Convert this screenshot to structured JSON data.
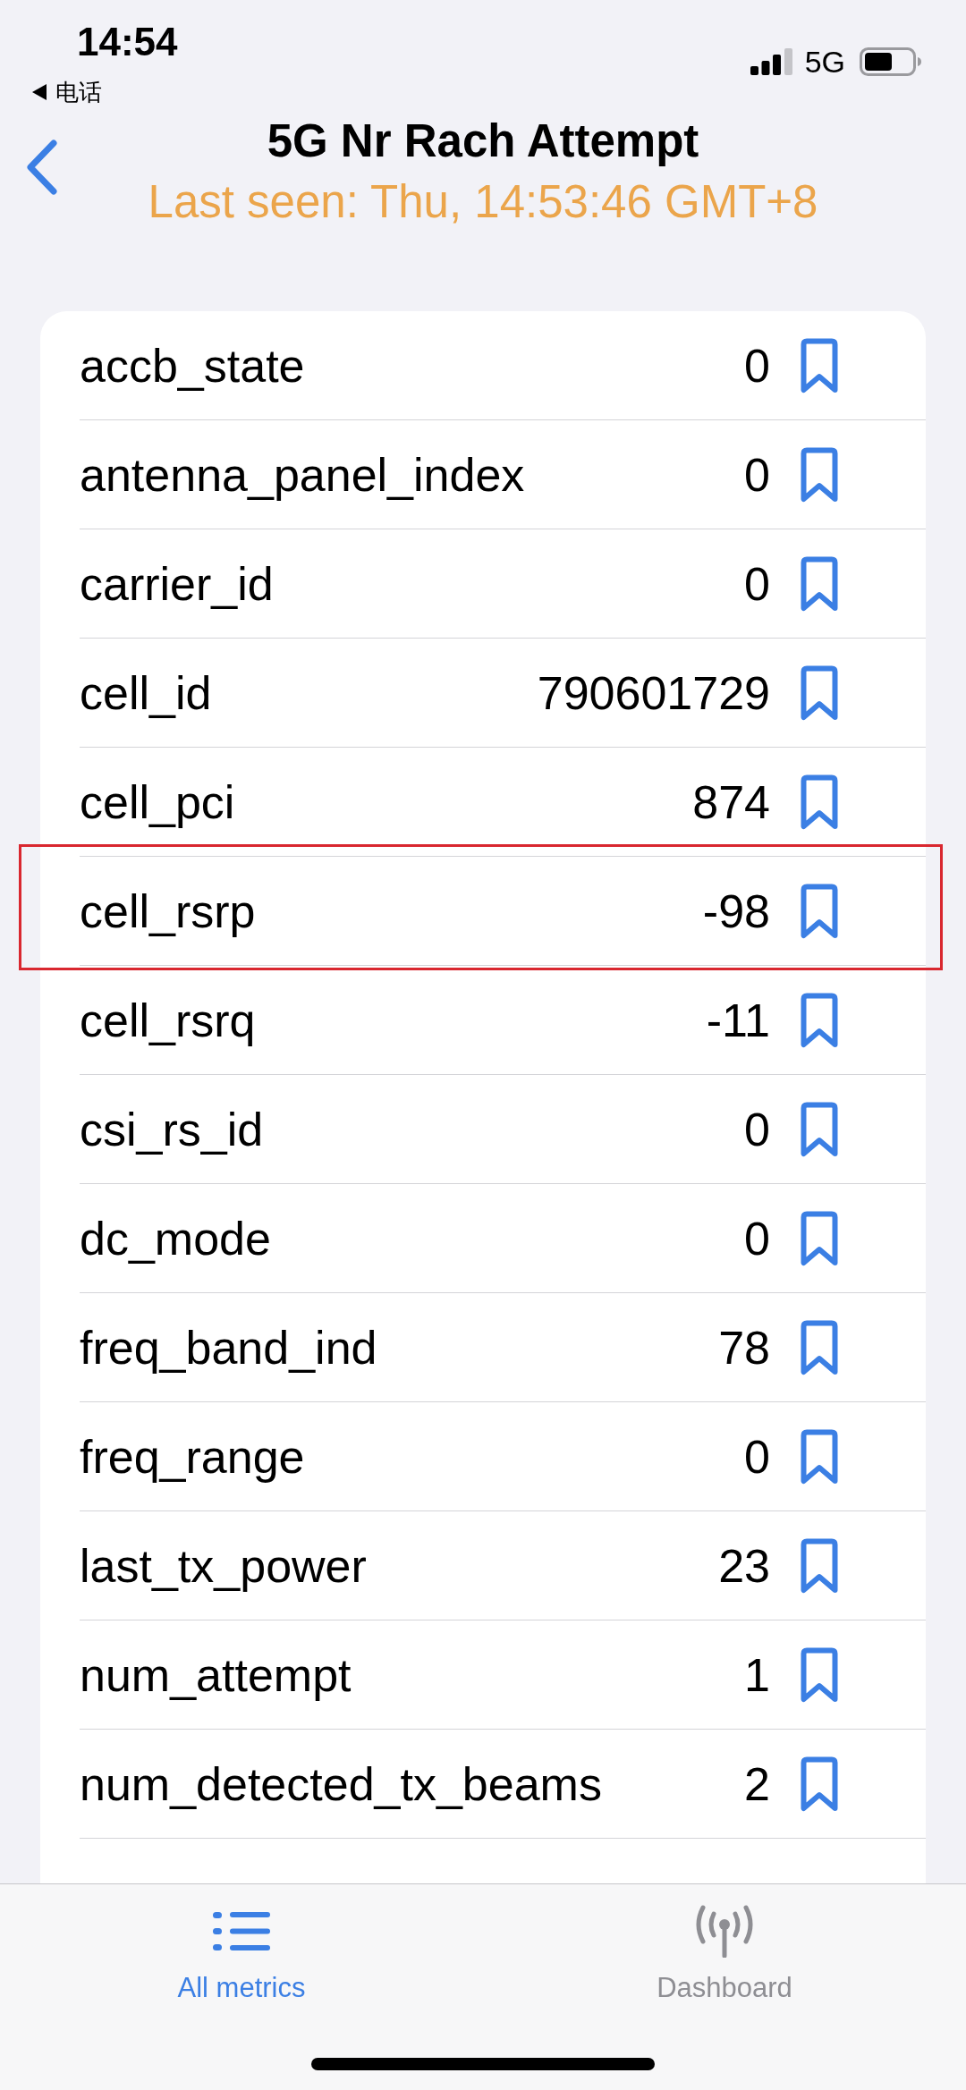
{
  "status_bar": {
    "time": "14:54",
    "back_app": "电话",
    "network": "5G"
  },
  "nav": {
    "title": "5G Nr Rach Attempt",
    "subtitle": "Last seen: Thu, 14:53:46 GMT+8"
  },
  "rows": [
    {
      "name": "accb_state",
      "value": "0",
      "bookmarked": false,
      "highlighted": false
    },
    {
      "name": "antenna_panel_index",
      "value": "0",
      "bookmarked": false,
      "highlighted": false
    },
    {
      "name": "carrier_id",
      "value": "0",
      "bookmarked": false,
      "highlighted": false
    },
    {
      "name": "cell_id",
      "value": "790601729",
      "bookmarked": false,
      "highlighted": false
    },
    {
      "name": "cell_pci",
      "value": "874",
      "bookmarked": false,
      "highlighted": false
    },
    {
      "name": "cell_rsrp",
      "value": "-98",
      "bookmarked": false,
      "highlighted": true
    },
    {
      "name": "cell_rsrq",
      "value": "-11",
      "bookmarked": false,
      "highlighted": false
    },
    {
      "name": "csi_rs_id",
      "value": "0",
      "bookmarked": false,
      "highlighted": false
    },
    {
      "name": "dc_mode",
      "value": "0",
      "bookmarked": false,
      "highlighted": false
    },
    {
      "name": "freq_band_ind",
      "value": "78",
      "bookmarked": false,
      "highlighted": false
    },
    {
      "name": "freq_range",
      "value": "0",
      "bookmarked": false,
      "highlighted": false
    },
    {
      "name": "last_tx_power",
      "value": "23",
      "bookmarked": false,
      "highlighted": false
    },
    {
      "name": "num_attempt",
      "value": "1",
      "bookmarked": false,
      "highlighted": false
    },
    {
      "name": "num_detected_tx_beams",
      "value": "2",
      "bookmarked": false,
      "highlighted": false
    }
  ],
  "tabs": [
    {
      "label": "All metrics",
      "selected": true
    },
    {
      "label": "Dashboard",
      "selected": false
    }
  ]
}
